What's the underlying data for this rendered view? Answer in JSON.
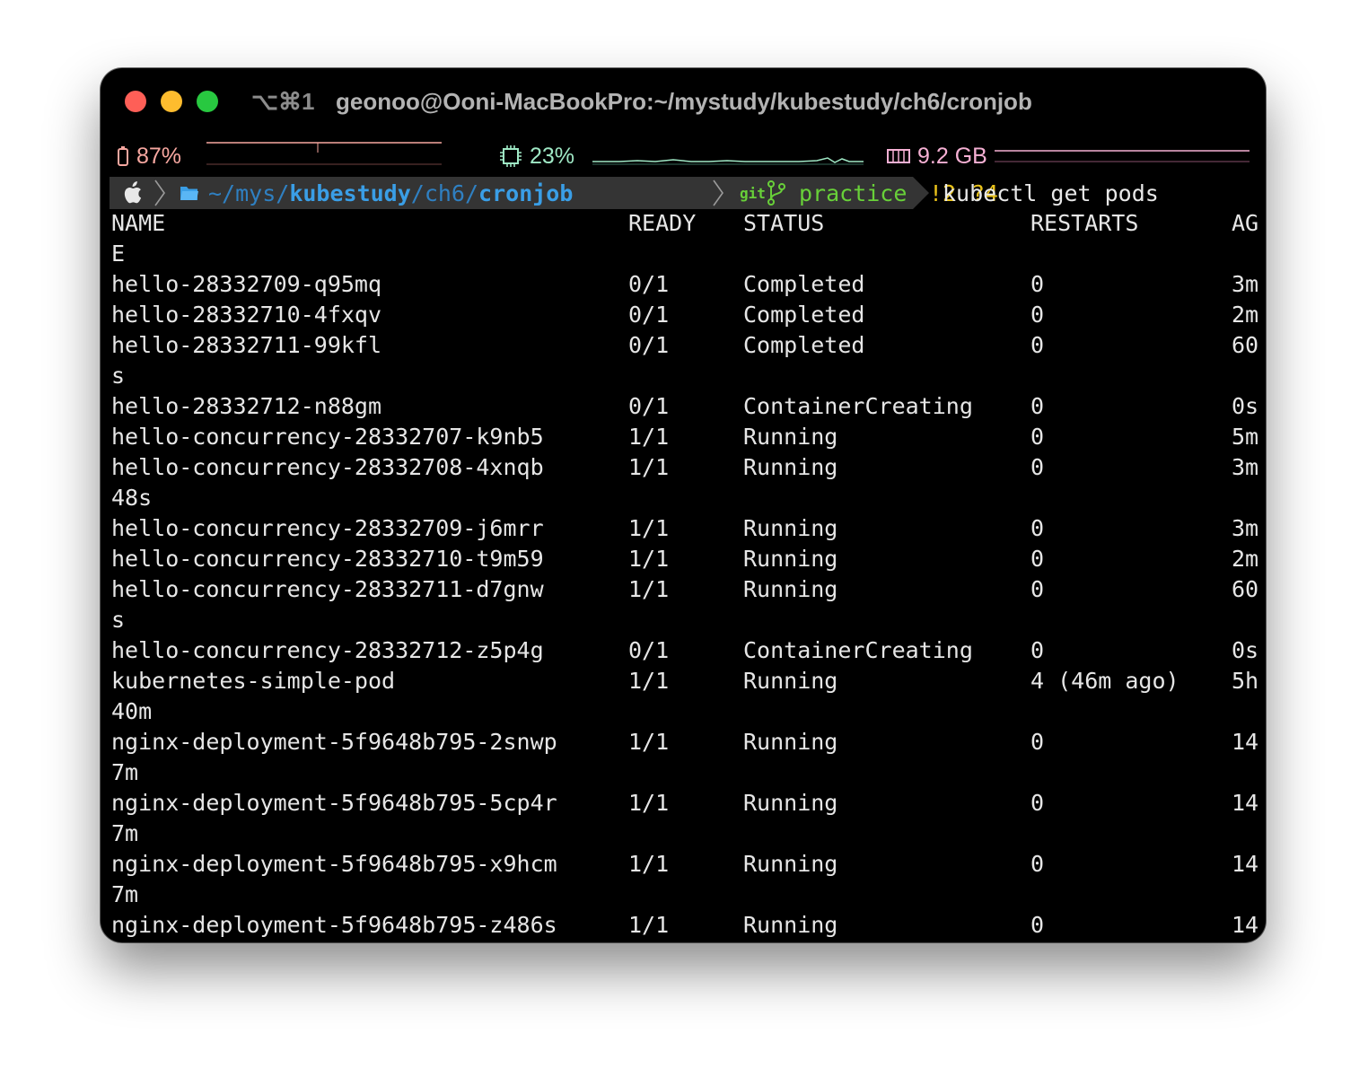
{
  "window": {
    "shortcut": "⌥⌘1",
    "title": "geonoo@Ooni-MacBookPro:~/mystudy/kubestudy/ch6/cronjob"
  },
  "status_bar": {
    "battery": "87%",
    "cpu": "23%",
    "memory": "9.2 GB",
    "colors": {
      "battery": "#f7a7a0",
      "cpu": "#9fe8c5",
      "memory": "#f6b0d4"
    }
  },
  "prompt": {
    "path_prefix": "~/mys/",
    "path_dir1": "kubestudy",
    "path_sep1": "/ch6/",
    "path_dir2": "cronjob",
    "git_label": "git",
    "branch": "practice",
    "modified": "!2",
    "untracked": "?4",
    "command": "kubectl get pods",
    "colors": {
      "path": "#3a9ee6",
      "git": "#68d039",
      "status": "#e8c11a"
    }
  },
  "columns": {
    "name": "NAME",
    "ready": "READY",
    "status": "STATUS",
    "restarts": "RESTARTS",
    "age": "AG"
  },
  "lines": [
    {
      "name": "NAME",
      "ready": "READY",
      "status": "STATUS",
      "restarts": "RESTARTS",
      "age": "AG"
    },
    {
      "name": "E"
    },
    {
      "name": "hello-28332709-q95mq",
      "ready": "0/1",
      "status": "Completed",
      "restarts": "0",
      "age": "3m"
    },
    {
      "name": "hello-28332710-4fxqv",
      "ready": "0/1",
      "status": "Completed",
      "restarts": "0",
      "age": "2m"
    },
    {
      "name": "hello-28332711-99kfl",
      "ready": "0/1",
      "status": "Completed",
      "restarts": "0",
      "age": "60"
    },
    {
      "name": "s"
    },
    {
      "name": "hello-28332712-n88gm",
      "ready": "0/1",
      "status": "ContainerCreating",
      "restarts": "0",
      "age": "0s"
    },
    {
      "name": "hello-concurrency-28332707-k9nb5",
      "ready": "1/1",
      "status": "Running",
      "restarts": "0",
      "age": "5m"
    },
    {
      "name": "hello-concurrency-28332708-4xnqb",
      "ready": "1/1",
      "status": "Running",
      "restarts": "0",
      "age": "3m"
    },
    {
      "name": "48s"
    },
    {
      "name": "hello-concurrency-28332709-j6mrr",
      "ready": "1/1",
      "status": "Running",
      "restarts": "0",
      "age": "3m"
    },
    {
      "name": "hello-concurrency-28332710-t9m59",
      "ready": "1/1",
      "status": "Running",
      "restarts": "0",
      "age": "2m"
    },
    {
      "name": "hello-concurrency-28332711-d7gnw",
      "ready": "1/1",
      "status": "Running",
      "restarts": "0",
      "age": "60"
    },
    {
      "name": "s"
    },
    {
      "name": "hello-concurrency-28332712-z5p4g",
      "ready": "0/1",
      "status": "ContainerCreating",
      "restarts": "0",
      "age": "0s"
    },
    {
      "name": "kubernetes-simple-pod",
      "ready": "1/1",
      "status": "Running",
      "restarts": "4 (46m ago)",
      "age": "5h"
    },
    {
      "name": "40m"
    },
    {
      "name": "nginx-deployment-5f9648b795-2snwp",
      "ready": "1/1",
      "status": "Running",
      "restarts": "0",
      "age": "14"
    },
    {
      "name": "7m"
    },
    {
      "name": "nginx-deployment-5f9648b795-5cp4r",
      "ready": "1/1",
      "status": "Running",
      "restarts": "0",
      "age": "14"
    },
    {
      "name": "7m"
    },
    {
      "name": "nginx-deployment-5f9648b795-x9hcm",
      "ready": "1/1",
      "status": "Running",
      "restarts": "0",
      "age": "14"
    },
    {
      "name": "7m"
    },
    {
      "name": "nginx-deployment-5f9648b795-z486s",
      "ready": "1/1",
      "status": "Running",
      "restarts": "0",
      "age": "14"
    }
  ]
}
